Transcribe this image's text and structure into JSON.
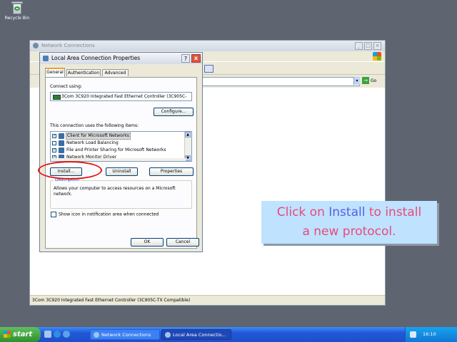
{
  "desktop": {
    "recycle_bin_label": "Recycle Bin"
  },
  "network_window": {
    "title": "Network Connections",
    "address_go_label": "Go",
    "status_text": "3Com 3C920 Integrated Fast Ethernet Controller (3C905C-TX Compatible)"
  },
  "dialog": {
    "title": "Local Area Connection Properties",
    "help_label": "?",
    "close_label": "x",
    "tabs": [
      "General",
      "Authentication",
      "Advanced"
    ],
    "connect_using_label": "Connect using:",
    "adapter_name": "3Com 3C920 Integrated Fast Ethernet Controller (3C905C-",
    "configure_label": "Configure...",
    "items_label": "This connection uses the following items:",
    "items": [
      {
        "label": "Client for Microsoft Networks",
        "checked": true,
        "selected": true,
        "check_mark": "✓"
      },
      {
        "label": "Network Load Balancing",
        "checked": false,
        "selected": false,
        "check_mark": ""
      },
      {
        "label": "File and Printer Sharing for Microsoft Networks",
        "checked": true,
        "selected": false,
        "check_mark": "✓"
      },
      {
        "label": "Network Monitor Driver",
        "checked": true,
        "selected": false,
        "check_mark": "✓"
      }
    ],
    "install_label": "Install...",
    "uninstall_label": "Uninstall",
    "properties_label": "Properties",
    "description_label": "Description",
    "description_text": "Allows your computer to access resources on a Microsoft network.",
    "show_icon_label": "Show icon in notification area when connected",
    "ok_label": "OK",
    "cancel_label": "Cancel"
  },
  "callout": {
    "prefix": "Click on ",
    "highlight": "Install",
    "suffix": " to install",
    "line2": "a new protocol."
  },
  "taskbar": {
    "start_label": "start",
    "tasks": [
      "Network Connections",
      "Local Area Connectio..."
    ],
    "language": "EN",
    "clock": "16:10"
  },
  "colors": {
    "callout_bg": "#bfe2ff",
    "callout_text": "#e84a7a",
    "callout_highlight": "#5560e0",
    "annotation_circle": "#e01818"
  }
}
